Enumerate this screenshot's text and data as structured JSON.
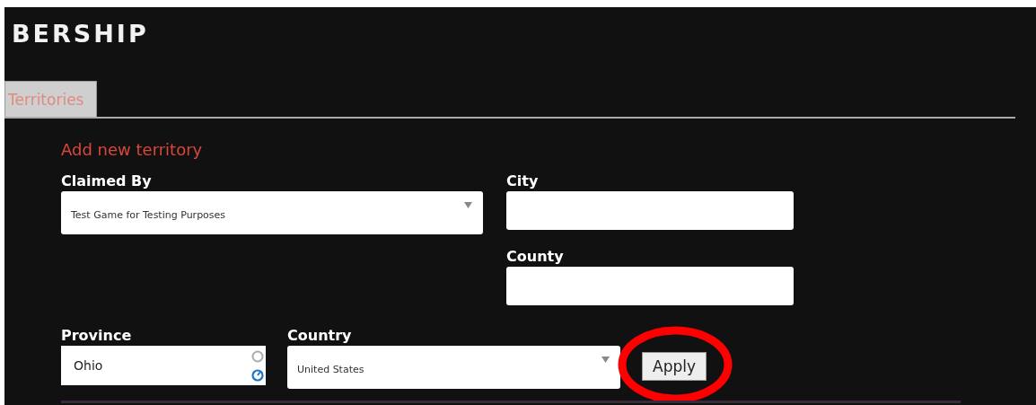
{
  "header": {
    "title": "BERSHIP"
  },
  "tabs": [
    {
      "label": "Territories",
      "selected": true
    }
  ],
  "form": {
    "heading": "Add new territory",
    "claimed_by": {
      "label": "Claimed By",
      "value": "Test Game for Testing Purposes"
    },
    "city": {
      "label": "City"
    },
    "county": {
      "label": "County"
    },
    "province": {
      "label": "Province",
      "value": "Ohio"
    },
    "country": {
      "label": "Country",
      "value": "United States"
    },
    "apply_button": "Apply"
  },
  "annotation": {
    "kind": "circle",
    "color": "#ff0000"
  }
}
